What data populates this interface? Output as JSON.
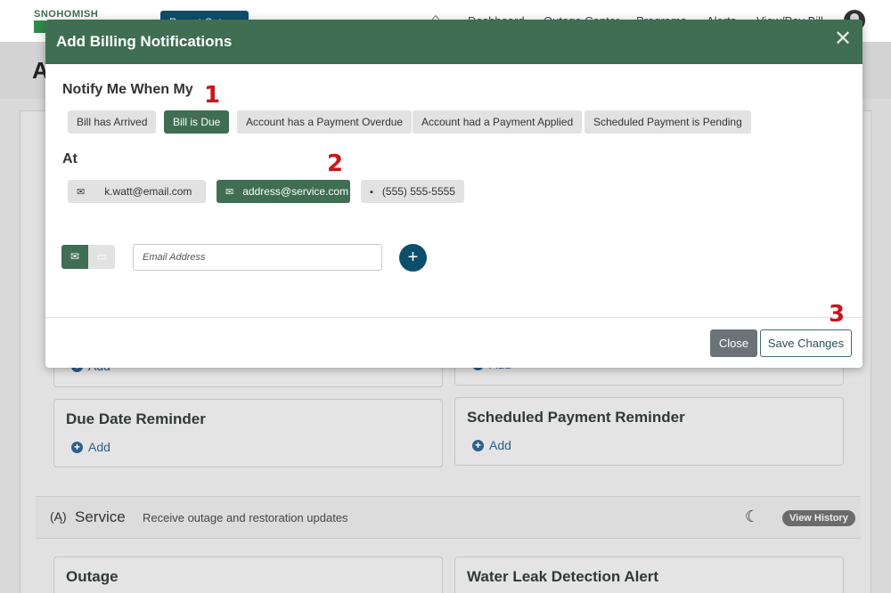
{
  "nav": {
    "logo_text": "SNOHOMISH",
    "report_outage_label": "Report Outage",
    "home_icon": "home-icon",
    "links": [
      "Dashboard",
      "Outage Center",
      "Programs",
      "Alerts",
      "View/Pay Bill"
    ],
    "user_icon": "user-avatar-icon"
  },
  "page": {
    "title_initial": "A"
  },
  "background_cards": {
    "add_label": "Add",
    "due_date_reminder": "Due Date Reminder",
    "scheduled_payment_reminder": "Scheduled Payment Reminder",
    "outage": "Outage",
    "water_leak": "Water Leak Detection Alert"
  },
  "service_section": {
    "title": "Service",
    "description": "Receive outage and restoration updates",
    "view_history_label": "View History",
    "icon": "antenna-icon",
    "moon_icon": "moon-icon"
  },
  "modal": {
    "title": "Add Billing Notifications",
    "close_icon": "close-icon",
    "notify_heading": "Notify Me When My",
    "events": [
      {
        "label": "Bill has Arrived",
        "selected": false
      },
      {
        "label": "Bill is Due",
        "selected": true
      },
      {
        "label": "Account has a Payment Overdue",
        "selected": false
      },
      {
        "label": "Account had a Payment Applied",
        "selected": false
      },
      {
        "label": "Scheduled Payment is Pending",
        "selected": false
      }
    ],
    "at_heading": "At",
    "contacts": [
      {
        "label": "k.watt@email.com",
        "icon": "envelope-icon",
        "selected": false
      },
      {
        "label": "address@service.com",
        "icon": "envelope-icon",
        "selected": true
      },
      {
        "label": "(555) 555-5555",
        "icon": "chat-icon",
        "selected": false
      }
    ],
    "new_contact": {
      "email_toggle_icon": "envelope-icon",
      "sms_toggle_icon": "chat-icon",
      "selected_type": "email",
      "placeholder": "Email Address",
      "value": ""
    },
    "close_label": "Close",
    "save_label": "Save Changes"
  },
  "annotations": [
    "1",
    "2",
    "3"
  ],
  "colors": {
    "brand_green": "#3f6e52",
    "teal_button": "#0d4f6b",
    "annotation_red": "#c8161d",
    "chip_gray": "#e2e2e2"
  }
}
